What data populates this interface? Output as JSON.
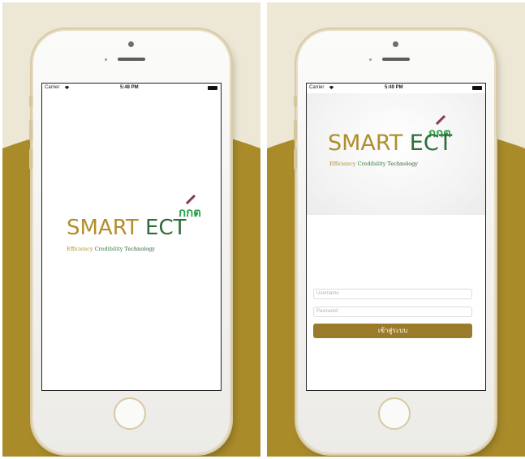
{
  "colors": {
    "gold": "#a98b2a",
    "cream": "#ede7d6",
    "smart_text": "#b18e2c",
    "ect_text": "#2f6c3a",
    "button": "#9a7b29"
  },
  "status_bar": {
    "carrier": "Carrier",
    "wifi_icon": "wifi-icon",
    "time_left": "5:48 PM",
    "time_right": "5:49 PM"
  },
  "logo": {
    "badge": "กกต",
    "word_smart": "SMART",
    "word_ect": "ECT",
    "tagline": {
      "efficiency": "Efficiency",
      "credibility": "Credibility",
      "technology": "Technology"
    }
  },
  "login": {
    "username_placeholder": "Username",
    "password_placeholder": "Password",
    "button_label": "เข้าสู่ระบบ"
  }
}
